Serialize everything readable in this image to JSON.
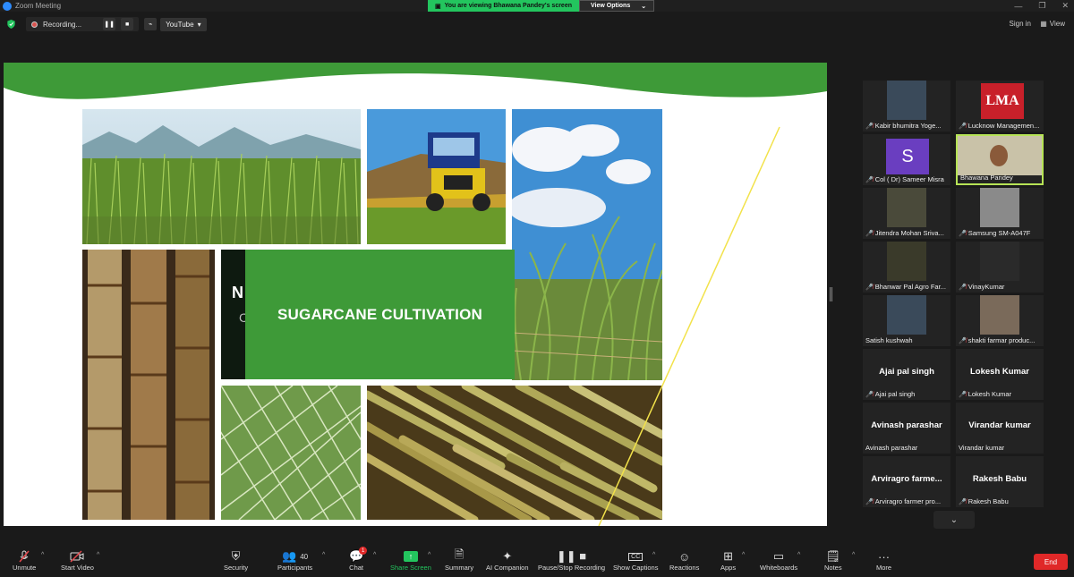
{
  "window": {
    "title": "Zoom Meeting"
  },
  "banner": {
    "viewing_text": "You are viewing Bhawana Pandey's screen",
    "view_options": "View Options"
  },
  "recording": {
    "label": "Recording...",
    "stream_label": "YouTube"
  },
  "top_right": {
    "sign_in": "Sign in",
    "view": "View"
  },
  "slide": {
    "title": "SUGARCANE CULTIVATION",
    "peek_text": "N",
    "peek_text2": "C"
  },
  "participants_gallery": [
    {
      "label": "Kabir bhumitra Yoge...",
      "muted": true,
      "kind": "video"
    },
    {
      "label": "Lucknow Managemen...",
      "muted": true,
      "kind": "logo",
      "logo_text": "LMA"
    },
    {
      "label": "Col ( Dr) Sameer Misra",
      "muted": true,
      "kind": "avatar",
      "initial": "S"
    },
    {
      "label": "Bhawana Pandey",
      "muted": false,
      "kind": "video",
      "active": true
    },
    {
      "label": "Jitendra Mohan Sriva...",
      "muted": true,
      "kind": "video"
    },
    {
      "label": "Samsung SM-A047F",
      "muted": true,
      "kind": "video"
    },
    {
      "label": "Bhanwar Pal Agro Far...",
      "muted": true,
      "kind": "video"
    },
    {
      "label": "VinayKumar",
      "muted": true,
      "kind": "video"
    },
    {
      "label": "Satish kushwah",
      "muted": false,
      "kind": "video"
    },
    {
      "label": "shakti farmar produc...",
      "muted": true,
      "kind": "video"
    },
    {
      "label": "Ajai pal singh",
      "muted": true,
      "kind": "name",
      "big": "Ajai pal singh"
    },
    {
      "label": "Lokesh Kumar",
      "muted": true,
      "kind": "name",
      "big": "Lokesh Kumar"
    },
    {
      "label": "Avinash parashar",
      "muted": false,
      "kind": "name",
      "big": "Avinash parashar"
    },
    {
      "label": "Virandar kumar",
      "muted": false,
      "kind": "name",
      "big": "Virandar kumar"
    },
    {
      "label": "Arviragro farmer pro...",
      "muted": true,
      "kind": "name",
      "big": "Arviragro  farme..."
    },
    {
      "label": "Rakesh Babu",
      "muted": true,
      "kind": "name",
      "big": "Rakesh Babu"
    }
  ],
  "bottom_bar": {
    "unmute": "Unmute",
    "start_video": "Start Video",
    "security": "Security",
    "participants": "Participants",
    "participants_count": "40",
    "chat": "Chat",
    "chat_badge": "1",
    "share_screen": "Share Screen",
    "summary": "Summary",
    "ai_companion": "AI Companion",
    "pause_stop_recording": "Pause/Stop Recording",
    "show_captions": "Show Captions",
    "reactions": "Reactions",
    "apps": "Apps",
    "whiteboards": "Whiteboards",
    "notes": "Notes",
    "more": "More",
    "end": "End"
  },
  "colors": {
    "accent_green": "#23c55e",
    "slide_green": "#3e9a38",
    "end_red": "#e02828",
    "active_border": "#b6e356"
  }
}
